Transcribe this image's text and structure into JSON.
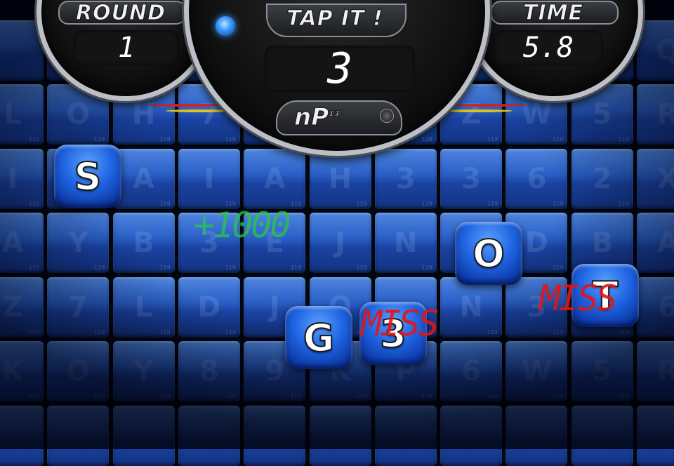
{
  "hud": {
    "round_label": "ROUND",
    "round_value": "1",
    "tap_label": "TAP IT !",
    "target_value": "3",
    "logo": "nP",
    "logo_sup": "13",
    "time_label": "TIME",
    "time_value": "5.8"
  },
  "grid": {
    "rows": [
      [
        "L",
        "O",
        "H",
        "7",
        "",
        "",
        "",
        "Z",
        "W",
        "5",
        "R"
      ],
      [
        "I",
        "",
        "A",
        "I",
        "A",
        "H",
        "3",
        "3",
        "6",
        "2",
        "X"
      ],
      [
        "A",
        "Y",
        "B",
        "3",
        "E",
        "J",
        "N",
        "",
        "D",
        "B",
        "A"
      ],
      [
        "Z",
        "7",
        "L",
        "D",
        "J",
        "Q",
        "",
        "N",
        "3",
        "",
        "6"
      ],
      [
        "K",
        "O",
        "Y",
        "8",
        "9",
        "K",
        "P",
        "6",
        "W",
        "5",
        "R"
      ],
      [
        "",
        "",
        "",
        "",
        "",
        "",
        "",
        "",
        "",
        "",
        ""
      ]
    ],
    "top_row": [
      "",
      "",
      "",
      "",
      "",
      "",
      "",
      "",
      "",
      "",
      "Q"
    ],
    "tile_num": "119"
  },
  "active_tiles": [
    {
      "letter": "S"
    },
    {
      "letter": "O"
    },
    {
      "letter": "T"
    },
    {
      "letter": "G"
    },
    {
      "letter": "3"
    }
  ],
  "feedback": {
    "bonus": "+1000",
    "miss_1": "MISS",
    "miss_2": "MISS"
  },
  "colors": {
    "tile": "#2a5fc6",
    "miss": "#e61414",
    "bonus": "#28c846"
  }
}
